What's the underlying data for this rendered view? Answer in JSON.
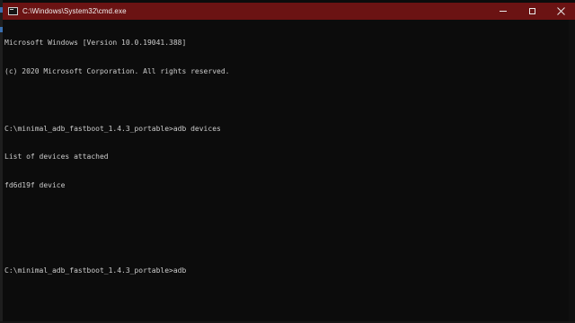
{
  "window": {
    "title": "C:\\Windows\\System32\\cmd.exe",
    "titlebar_color": "#6b1313",
    "background_color": "#0c0c0c",
    "text_color": "#cccccc"
  },
  "controls": {
    "minimize_icon": "minimize-icon",
    "maximize_icon": "maximize-icon",
    "close_icon": "close-icon"
  },
  "console": {
    "lines": [
      "Microsoft Windows [Version 10.0.19041.388]",
      "(c) 2020 Microsoft Corporation. All rights reserved.",
      "",
      "C:\\minimal_adb_fastboot_1.4.3_portable>adb devices",
      "List of devices attached",
      "fd6d19f device",
      "",
      "",
      "C:\\minimal_adb_fastboot_1.4.3_portable>adb"
    ]
  }
}
